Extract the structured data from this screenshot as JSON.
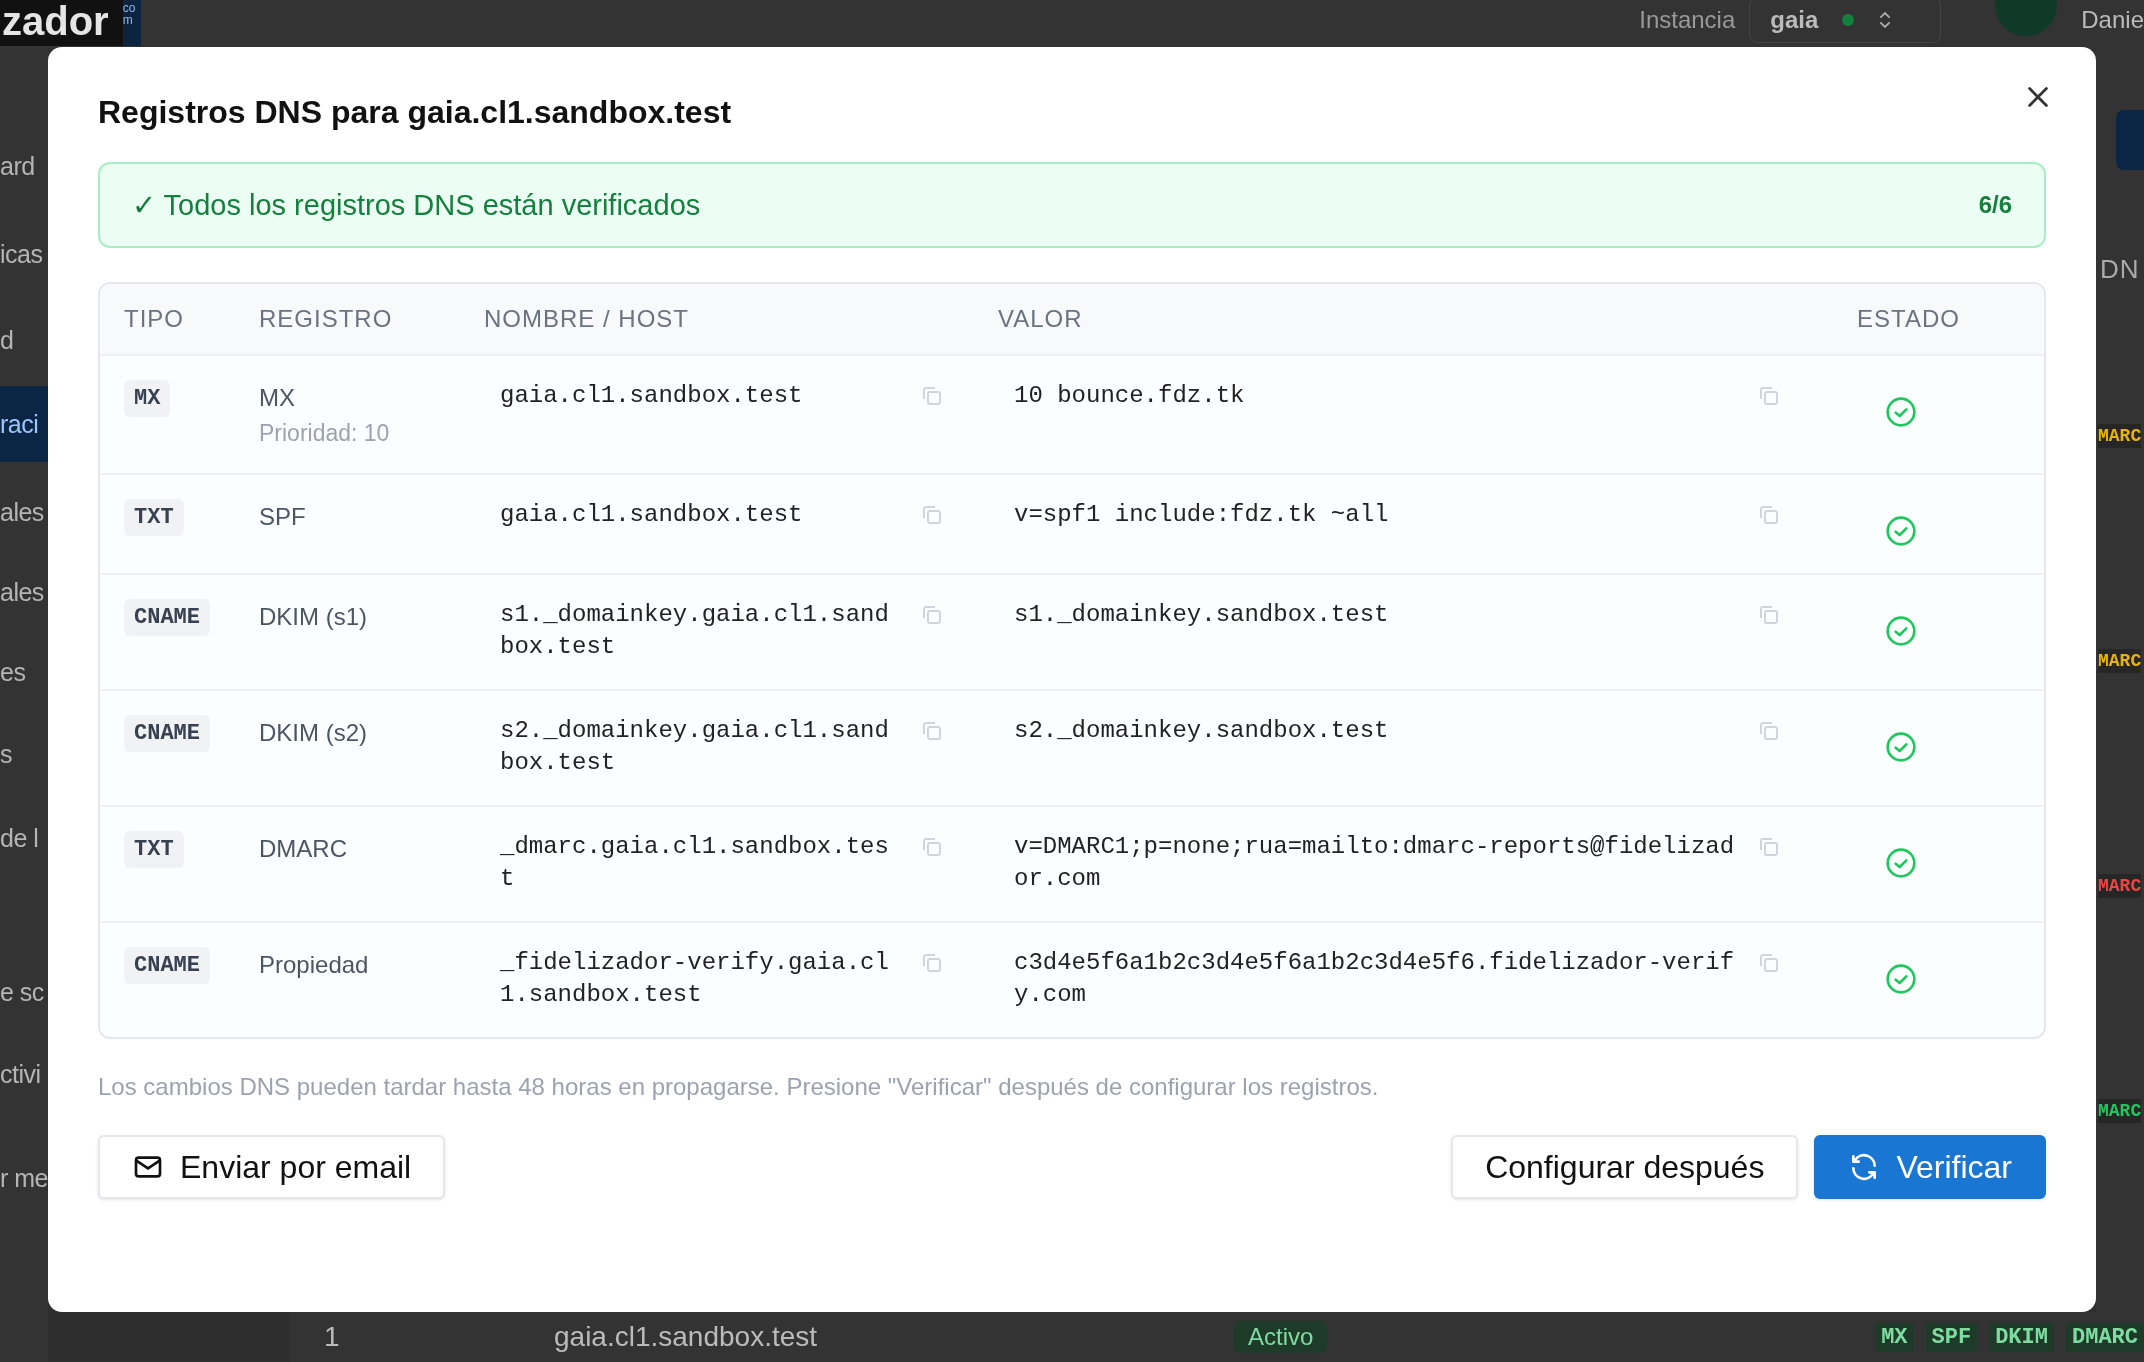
{
  "background": {
    "logo": {
      "text": "zador",
      "suffix": "com"
    },
    "topbar": {
      "instance_label": "Instancia",
      "instance_value": "gaia",
      "user": "Danie"
    },
    "sidebar": [
      {
        "label": "ard",
        "selected": false
      },
      {
        "label": "icas",
        "selected": false
      },
      {
        "label": "d",
        "selected": false
      },
      {
        "label": "raci",
        "selected": true
      },
      {
        "label": "ales",
        "selected": false
      },
      {
        "label": "ales",
        "selected": false
      },
      {
        "label": "es",
        "selected": false
      },
      {
        "label": "s",
        "selected": false
      },
      {
        "label": "de l",
        "selected": false
      },
      {
        "label": "e sc",
        "selected": false
      },
      {
        "label": "ctivi",
        "selected": false
      },
      {
        "label": "r me",
        "selected": false
      }
    ],
    "right_header": "DN",
    "right_badges": [
      {
        "label": "MARC",
        "color": "#eab308"
      },
      {
        "label": "MARC",
        "color": "#eab308"
      },
      {
        "label": "MARC",
        "color": "#ef4444"
      },
      {
        "label": "MARC",
        "color": "#22c55e"
      }
    ],
    "bottom_row": {
      "index": "1",
      "domain": "gaia.cl1.sandbox.test",
      "status": "Activo",
      "records": [
        "MX",
        "SPF",
        "DKIM",
        "DMARC"
      ]
    }
  },
  "dialog": {
    "title": "Registros DNS para gaia.cl1.sandbox.test",
    "banner": {
      "message": "✓ Todos los registros DNS están verificados",
      "count": "6/6"
    },
    "table": {
      "columns": [
        "TIPO",
        "REGISTRO",
        "NOMBRE / HOST",
        "VALOR",
        "ESTADO"
      ],
      "rows": [
        {
          "type": "MX",
          "record": "MX",
          "note": "Prioridad: 10",
          "host": "gaia.cl1.sandbox.test",
          "value": "10 bounce.fdz.tk",
          "verified": true
        },
        {
          "type": "TXT",
          "record": "SPF",
          "host": "gaia.cl1.sandbox.test",
          "value": "v=spf1 include:fdz.tk ~all",
          "verified": true
        },
        {
          "type": "CNAME",
          "record": "DKIM (s1)",
          "host": "s1._domainkey.gaia.cl1.sandbox.test",
          "value": "s1._domainkey.sandbox.test",
          "verified": true
        },
        {
          "type": "CNAME",
          "record": "DKIM (s2)",
          "host": "s2._domainkey.gaia.cl1.sandbox.test",
          "value": "s2._domainkey.sandbox.test",
          "verified": true
        },
        {
          "type": "TXT",
          "record": "DMARC",
          "host": "_dmarc.gaia.cl1.sandbox.test",
          "value": "v=DMARC1;p=none;rua=mailto:dmarc-reports@fidelizador.com",
          "verified": true
        },
        {
          "type": "CNAME",
          "record": "Propiedad",
          "host": "_fidelizador-verify.gaia.cl1.sandbox.test",
          "value": "c3d4e5f6a1b2c3d4e5f6a1b2c3d4e5f6.fidelizador-verify.com",
          "verified": true
        }
      ]
    },
    "footnote": "Los cambios DNS pueden tardar hasta 48 horas en propagarse. Presione \"Verificar\" después de configurar los registros.",
    "buttons": {
      "email": "Enviar por email",
      "later": "Configurar después",
      "verify": "Verificar"
    }
  }
}
